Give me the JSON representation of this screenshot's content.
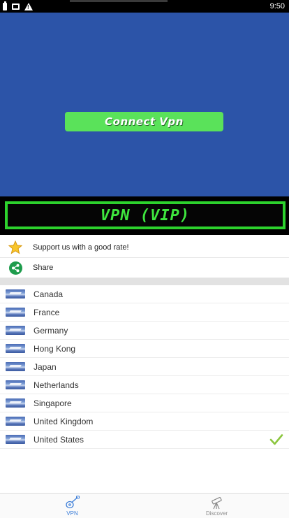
{
  "status_bar": {
    "time": "9:50",
    "icons": [
      "battery-icon",
      "photo-icon",
      "warning-icon"
    ]
  },
  "connect": {
    "button_label": "Connect Vpn"
  },
  "banner": {
    "label": "VPN (VIP)"
  },
  "actions": [
    {
      "icon": "star-icon",
      "label": "Support us with a good rate!"
    },
    {
      "icon": "share-icon",
      "label": "Share"
    }
  ],
  "countries": [
    {
      "name": "Canada",
      "selected": false
    },
    {
      "name": "France",
      "selected": false
    },
    {
      "name": "Germany",
      "selected": false
    },
    {
      "name": "Hong Kong",
      "selected": false
    },
    {
      "name": "Japan",
      "selected": false
    },
    {
      "name": "Netherlands",
      "selected": false
    },
    {
      "name": "Singapore",
      "selected": false
    },
    {
      "name": "United Kingdom",
      "selected": false
    },
    {
      "name": "United States",
      "selected": true
    }
  ],
  "bottom_nav": [
    {
      "icon": "guitar-icon",
      "label": "VPN",
      "active": true
    },
    {
      "icon": "telescope-icon",
      "label": "Discover",
      "active": false
    }
  ],
  "colors": {
    "panel_blue": "#2c54a8",
    "connect_green": "#5ae25a",
    "banner_green": "#2dd22d",
    "active_tab_blue": "#3b7dd8",
    "check_green": "#8cc63f"
  }
}
